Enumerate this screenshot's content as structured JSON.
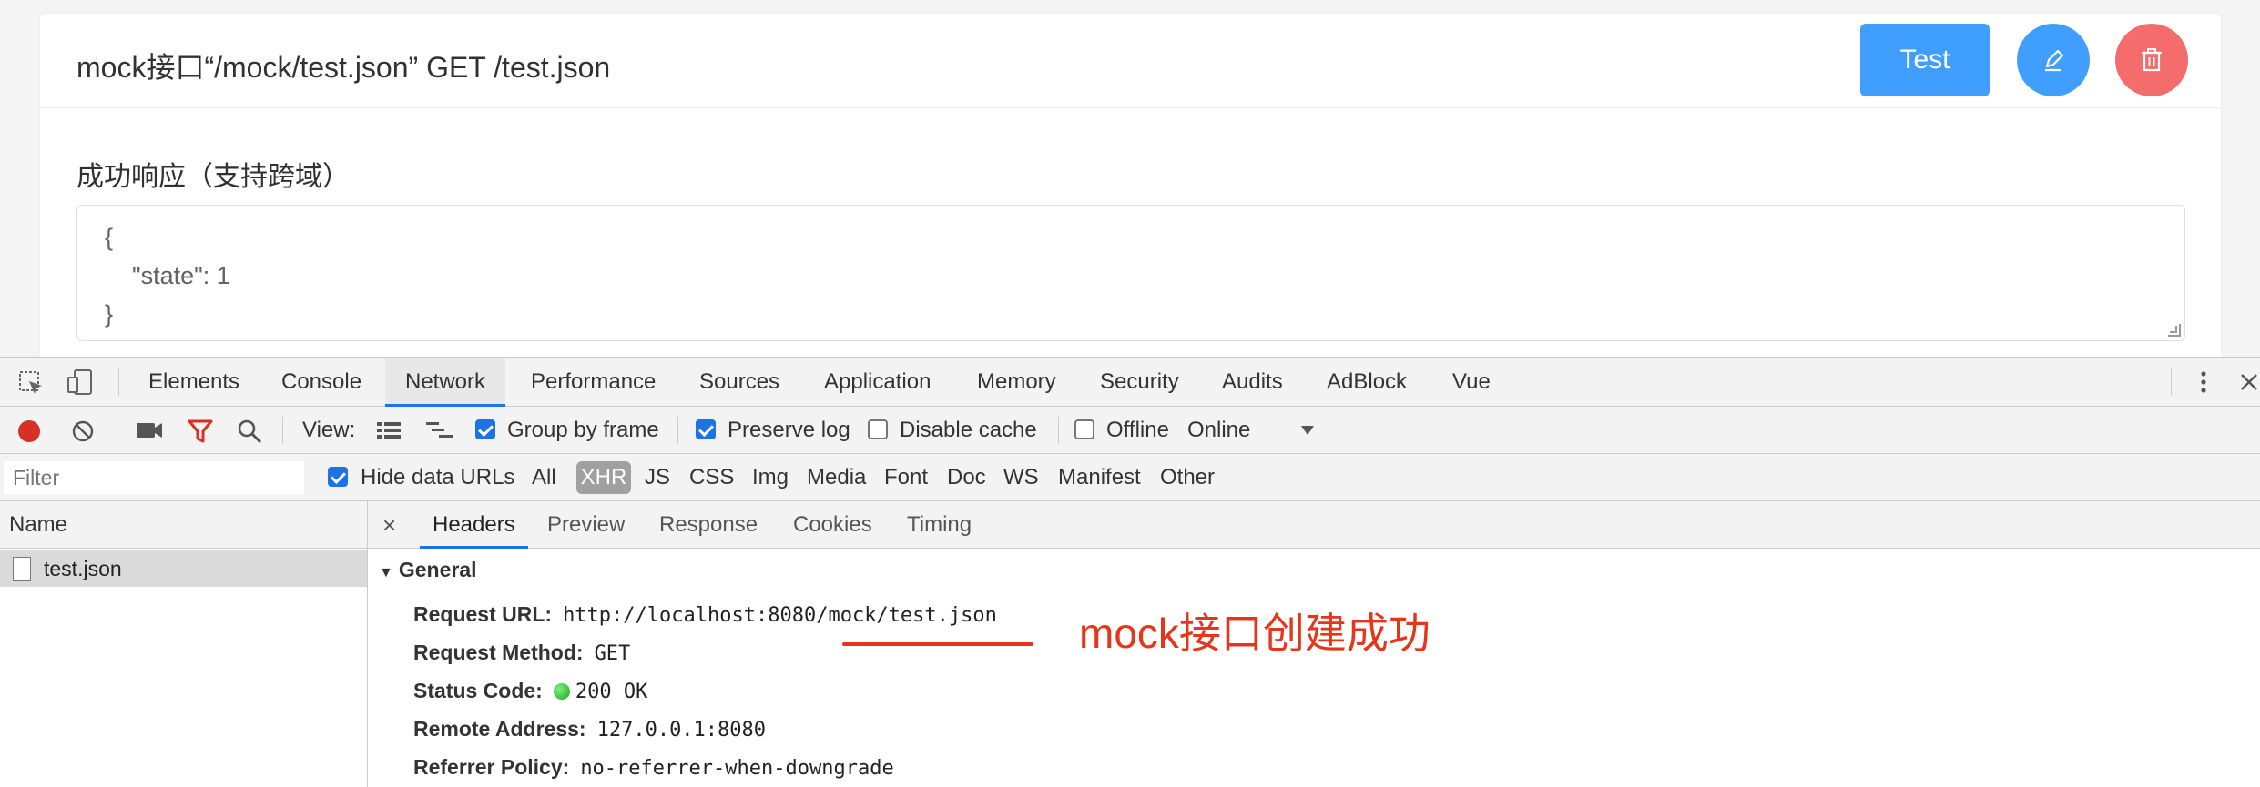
{
  "card": {
    "title": "mock接口“/mock/test.json” GET /test.json",
    "test_button": "Test",
    "section_label": "成功响应（支持跨域）",
    "json_lines": [
      "{",
      "\"state\": 1",
      "}"
    ]
  },
  "devtools": {
    "tabs": [
      "Elements",
      "Console",
      "Network",
      "Performance",
      "Sources",
      "Application",
      "Memory",
      "Security",
      "Audits",
      "AdBlock",
      "Vue"
    ],
    "active_tab": "Network",
    "toolbar": {
      "view_label": "View:",
      "group_by_frame": "Group by frame",
      "preserve_log": "Preserve log",
      "disable_cache": "Disable cache",
      "offline": "Offline",
      "throttle": "Online"
    },
    "filter": {
      "placeholder": "Filter",
      "hide_data_urls": "Hide data URLs",
      "types": [
        "All",
        "XHR",
        "JS",
        "CSS",
        "Img",
        "Media",
        "Font",
        "Doc",
        "WS",
        "Manifest",
        "Other"
      ],
      "active_type": "XHR"
    },
    "requests": {
      "header": "Name",
      "items": [
        "test.json"
      ]
    },
    "detail": {
      "tabs": [
        "Headers",
        "Preview",
        "Response",
        "Cookies",
        "Timing"
      ],
      "active_tab": "Headers",
      "general_title": "General",
      "request_url_label": "Request URL:",
      "request_url": "http://localhost:8080/mock/test.json",
      "request_method_label": "Request Method:",
      "request_method": "GET",
      "status_code_label": "Status Code:",
      "status_code": "200 OK",
      "remote_address_label": "Remote Address:",
      "remote_address": "127.0.0.1:8080",
      "referrer_policy_label": "Referrer Policy:",
      "referrer_policy": "no-referrer-when-downgrade"
    }
  },
  "annotation": {
    "text": "mock接口创建成功",
    "color": "#e5361b"
  },
  "colors": {
    "primary": "#409eff",
    "danger": "#f56c6c",
    "devtools_accent": "#1a73e8"
  }
}
